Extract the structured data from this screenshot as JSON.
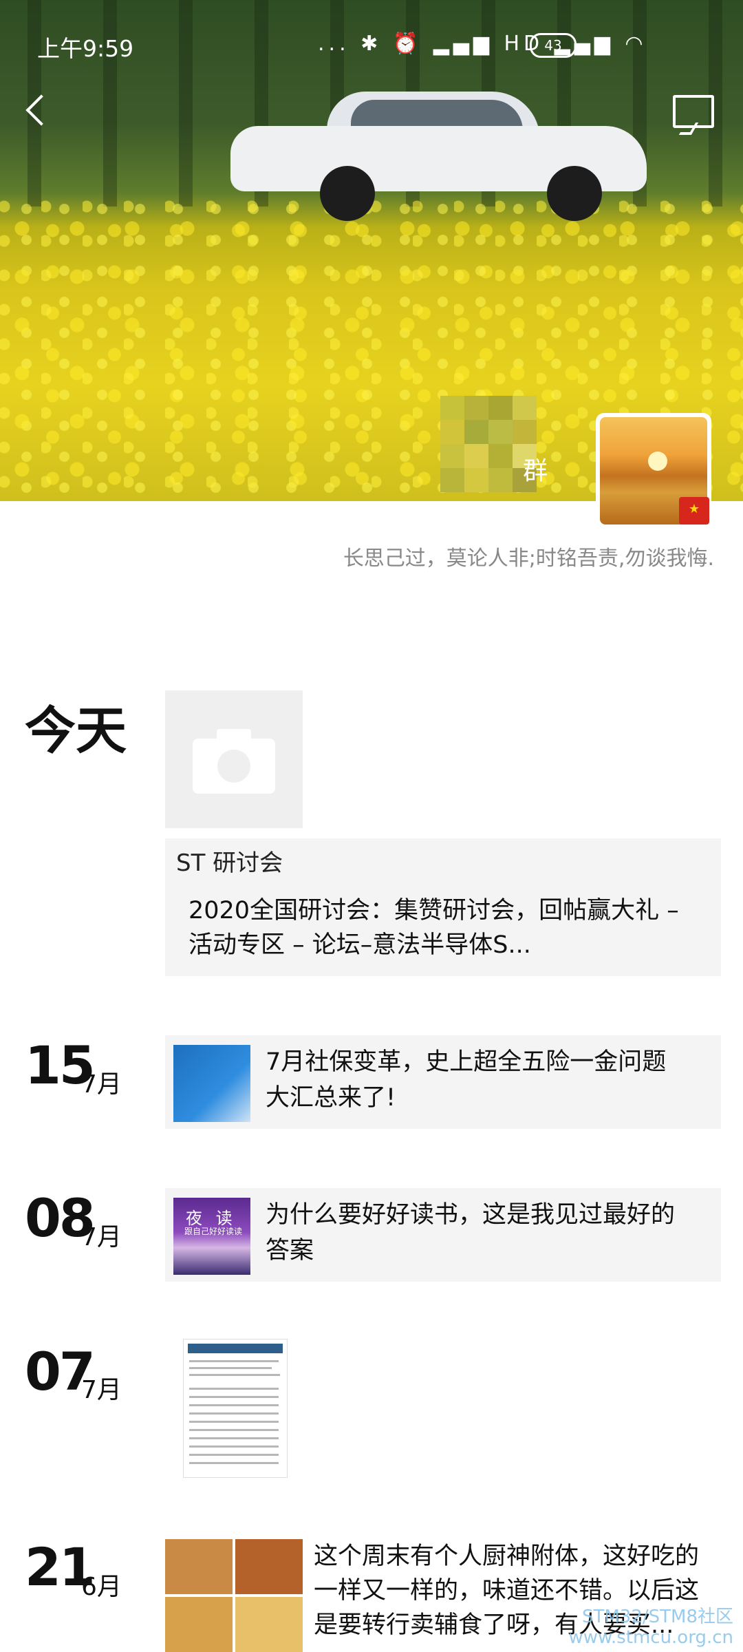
{
  "status_bar": {
    "time": "上午9:59",
    "icons_text": "... ✱ ⏰ ▂▄▆ HD ▂▄▆ ◠",
    "battery": "43"
  },
  "profile": {
    "nickname_visible": "群",
    "signature": "长思己过，莫论人非;时铭吾责,勿谈我悔."
  },
  "timeline": [
    {
      "day_label": "今天",
      "card_title": "ST 研讨会",
      "text_lines": [
        "2020全国研讨会：集赞研讨会，回帖赢大礼 –",
        "活动专区 – 论坛–意法半导体S..."
      ]
    },
    {
      "day": "15",
      "month": "7月",
      "text_lines": [
        "7月社保变革，史上超全五险一金问题",
        "大汇总来了!"
      ]
    },
    {
      "day": "08",
      "month": "7月",
      "thumb_title": "夜 读",
      "thumb_sub": "跟自己好好读读",
      "text_lines": [
        "为什么要好好读书，这是我见过最好的",
        "答案"
      ]
    },
    {
      "day": "07",
      "month": "7月"
    },
    {
      "day": "21",
      "month": "6月",
      "text_lines": [
        "这个周末有个人厨神附体，这好吃的",
        "一样又一样的，味道还不错。以后这",
        "是要转行卖辅食了呀，有人要买..."
      ]
    }
  ],
  "watermark": {
    "line1": "STM32/STM8社区",
    "line2": "www.stmcu.org.cn"
  }
}
